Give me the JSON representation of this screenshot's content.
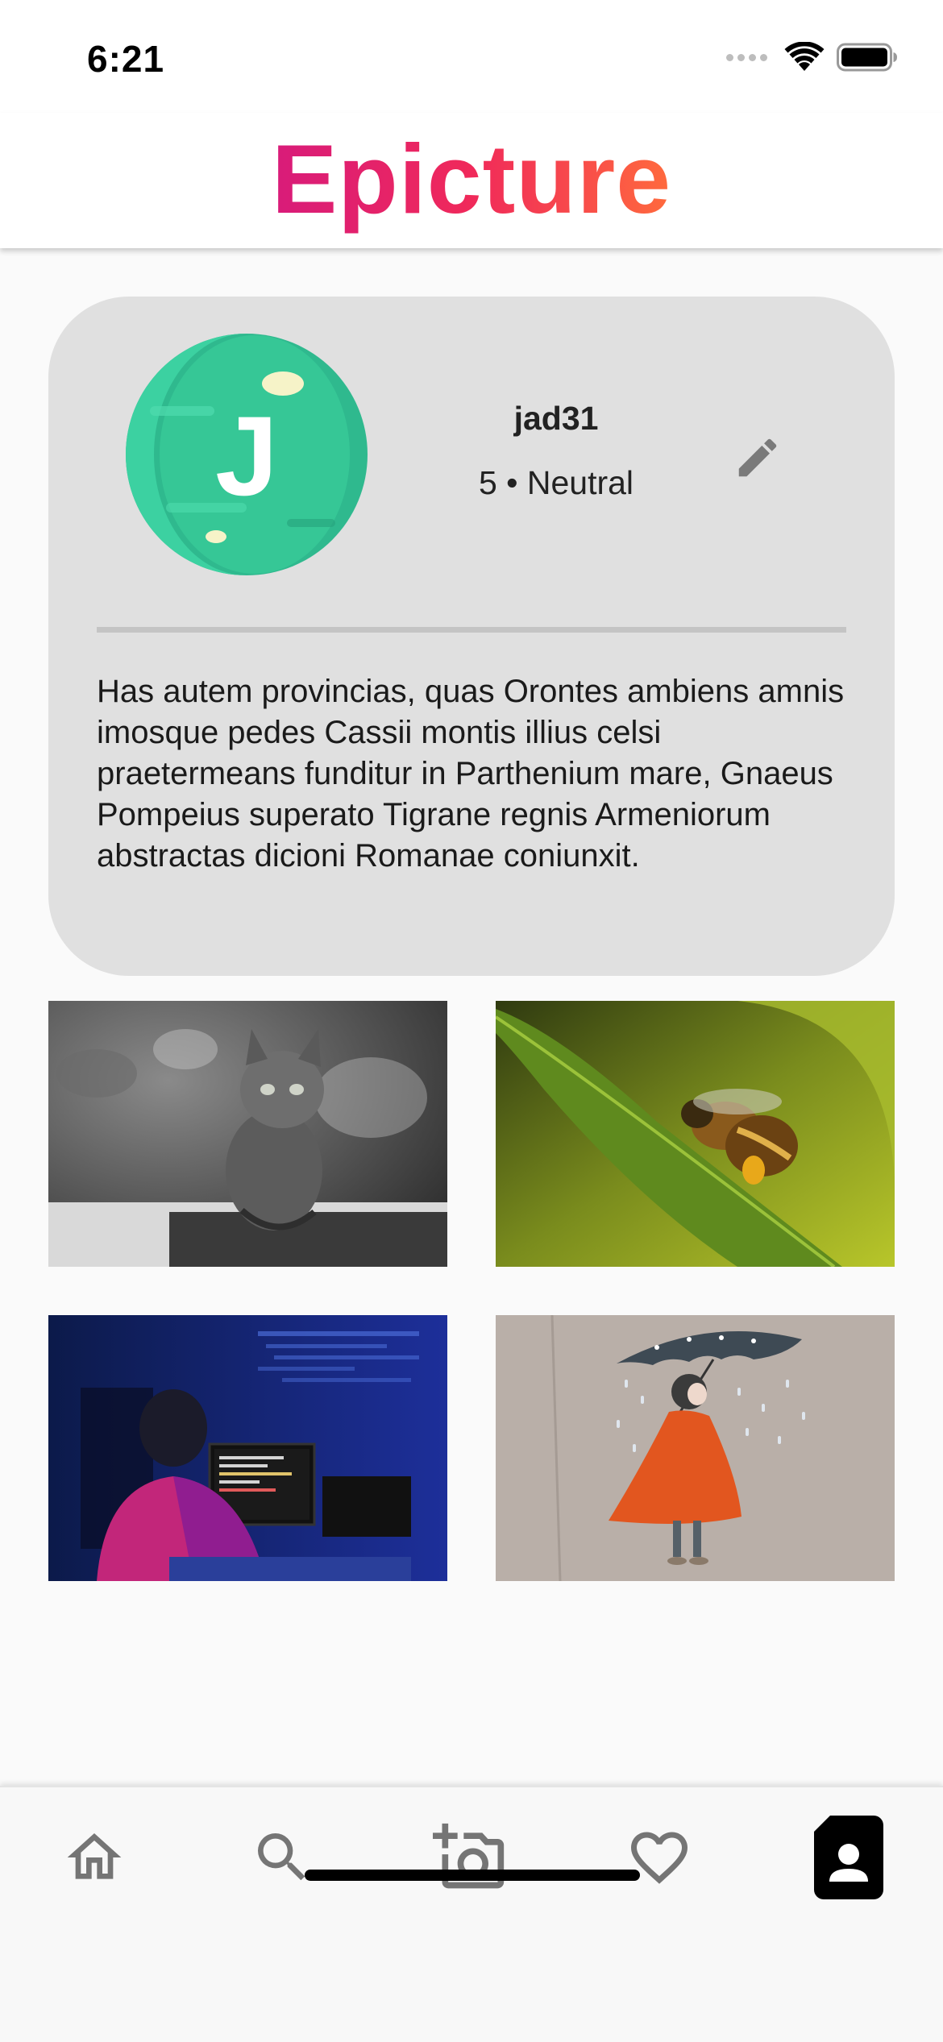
{
  "status_bar": {
    "time": "6:21"
  },
  "header": {
    "title": "Epicture",
    "gradient_start": "#D81B7A",
    "gradient_mid": "#F0295A",
    "gradient_end": "#FF6A3D"
  },
  "profile": {
    "avatar_letter": "J",
    "username": "jad31",
    "meta": "5 • Neutral",
    "bio": "Has autem provincias, quas Orontes ambiens amnis imosque pedes Cassii montis illius celsi praetermeans funditur in Parthenium mare, Gnaeus Pompeius superato Tigrane regnis Armeniorum abstractas dicioni Romanae coniunxit.",
    "card_color": "#e0e0e0",
    "avatar_color": "#33c99a"
  },
  "gallery": [
    {
      "subject": "kitten"
    },
    {
      "subject": "bee on leaf"
    },
    {
      "subject": "programmer at computer"
    },
    {
      "subject": "girl with umbrella"
    }
  ],
  "bottom_nav": {
    "items": [
      {
        "icon": "home-icon",
        "active": false
      },
      {
        "icon": "search-icon",
        "active": false
      },
      {
        "icon": "add-photo-icon",
        "active": false
      },
      {
        "icon": "heart-icon",
        "active": false
      },
      {
        "icon": "profile-icon",
        "active": true
      }
    ],
    "inactive_color": "#757575",
    "active_color": "#000000"
  }
}
